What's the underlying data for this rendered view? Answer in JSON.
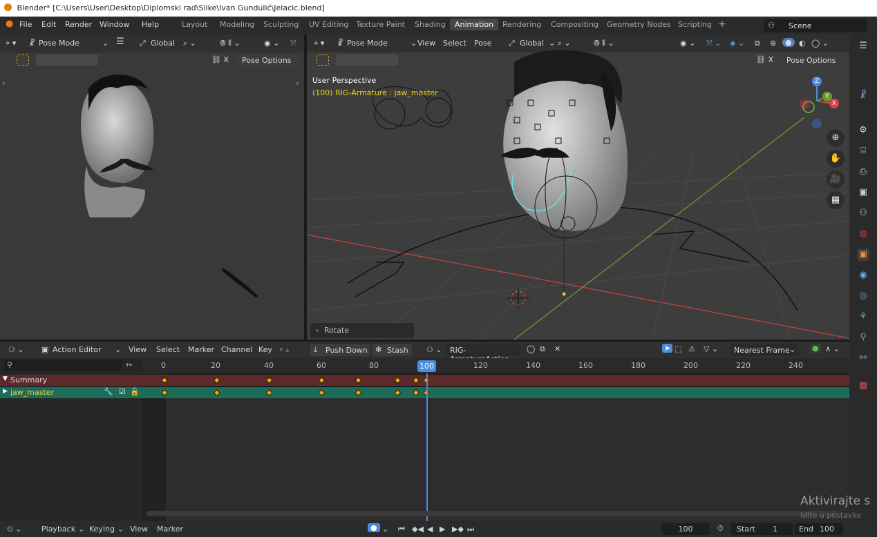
{
  "window": {
    "title": "Blender* [C:\\Users\\User\\Desktop\\Diplomski rad\\Slike\\Ivan Gundulić\\Jelacic.blend]"
  },
  "menu": {
    "file": "File",
    "edit": "Edit",
    "render": "Render",
    "window": "Window",
    "help": "Help"
  },
  "workspaces": [
    "Layout",
    "Modeling",
    "Sculpting",
    "UV Editing",
    "Texture Paint",
    "Shading",
    "Animation",
    "Rendering",
    "Compositing",
    "Geometry Nodes",
    "Scripting"
  ],
  "active_workspace": "Animation",
  "scene": {
    "label": "Scene"
  },
  "left_viewport": {
    "mode": "Pose Mode",
    "orientation": "Global",
    "pose_options": "Pose Options"
  },
  "right_viewport": {
    "mode": "Pose Mode",
    "view": "View",
    "select": "Select",
    "pose": "Pose",
    "orientation": "Global",
    "pose_options": "Pose Options",
    "perspective": "User Perspective",
    "active_object": "(100) RIG-Armature : jaw_master",
    "operator_panel": "Rotate",
    "gizmo_axes": {
      "z": "Z",
      "y": "Y",
      "x": "X"
    }
  },
  "action_editor": {
    "editor_type": "Action Editor",
    "view": "View",
    "select": "Select",
    "marker": "Marker",
    "channel": "Channel",
    "key": "Key",
    "push_down": "Push Down",
    "stash": "Stash",
    "action_name": "RIG-ArmatureAction",
    "snap": "Nearest Frame"
  },
  "timeline": {
    "ticks": [
      "0",
      "20",
      "40",
      "60",
      "80",
      "100",
      "120",
      "140",
      "160",
      "180",
      "200",
      "220",
      "240"
    ],
    "current_frame": "100"
  },
  "channels": [
    {
      "name": "Summary"
    },
    {
      "name": "jaw_master"
    }
  ],
  "keyframes": [
    0,
    20,
    40,
    60,
    74,
    89,
    96,
    100
  ],
  "statusbar": {
    "playback": "Playback",
    "keying": "Keying",
    "view": "View",
    "marker": "Marker",
    "frame": "100",
    "start_label": "Start",
    "start": "1",
    "end_label": "End",
    "end": "100"
  },
  "watermark": {
    "line1": "Aktivirajte s",
    "line2": "Idite u postavke"
  },
  "colors": {
    "accent": "#4a8ce0",
    "keyframe": "#f3a716",
    "summary_row": "#5c2a2a",
    "channel_row": "#1e6b58",
    "x_axis": "#c94040",
    "y_axis": "#6c9a2e"
  }
}
